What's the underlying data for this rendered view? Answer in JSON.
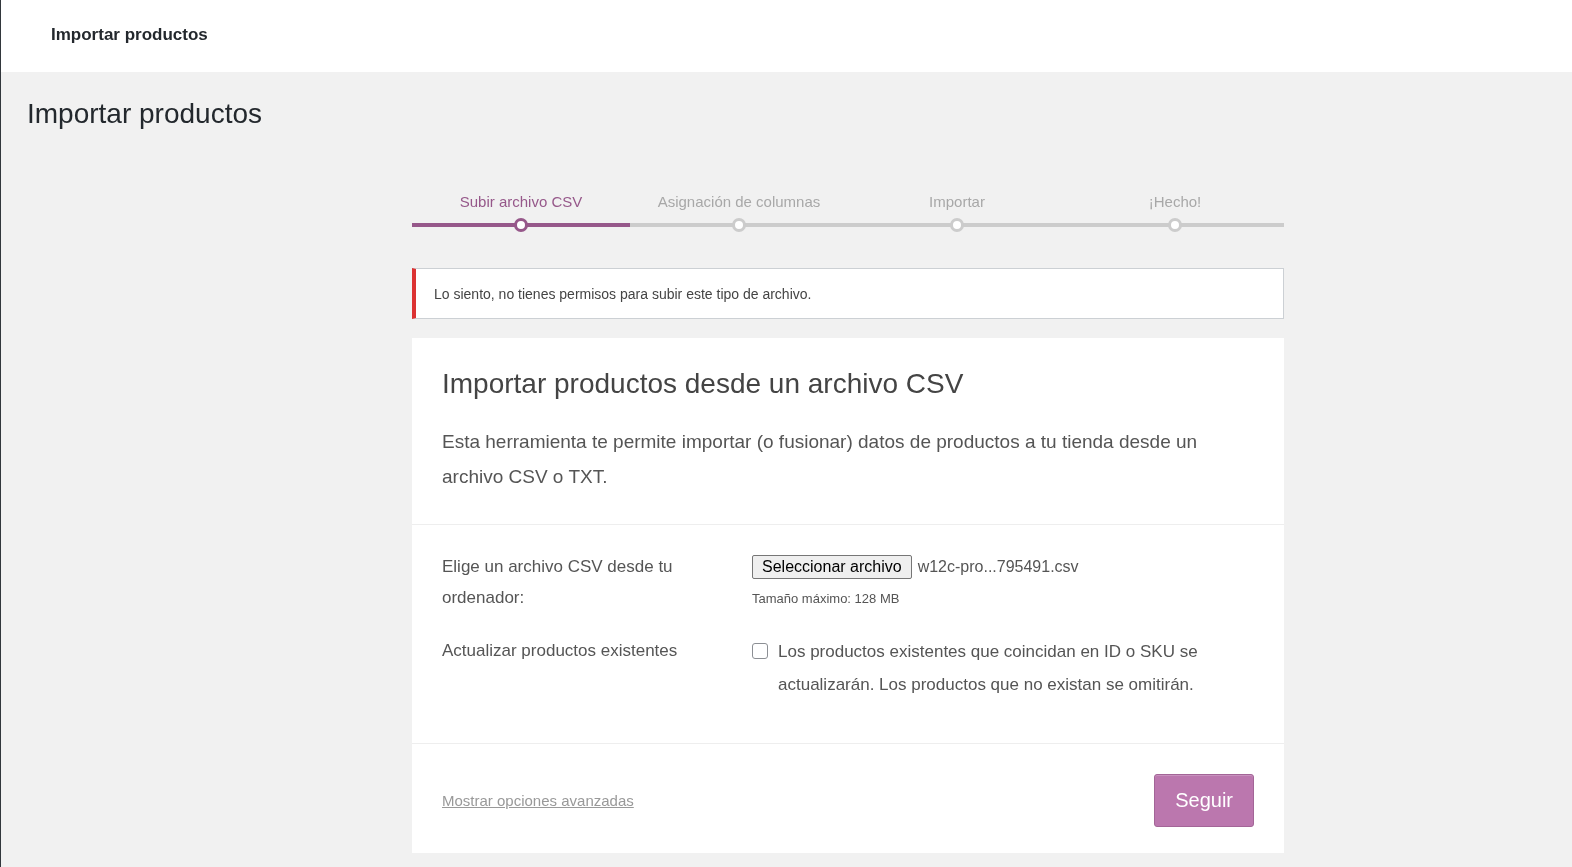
{
  "top_bar": {
    "title": "Importar productos"
  },
  "page_title": "Importar productos",
  "steps": [
    {
      "label": "Subir archivo CSV",
      "selected": true
    },
    {
      "label": "Asignación de columnas",
      "selected": false
    },
    {
      "label": "Importar",
      "selected": false
    },
    {
      "label": "¡Hecho!",
      "selected": false
    }
  ],
  "notice": {
    "kind": "error",
    "text": "Lo siento, no tienes permisos para subir este tipo de archivo."
  },
  "card": {
    "title": "Importar productos desde un archivo CSV",
    "description": "Esta herramienta te permite importar (o fusionar) datos de productos a tu tienda desde un archivo CSV o TXT.",
    "file_field": {
      "label": "Elige un archivo CSV desde tu ordenador:",
      "button": "Seleccionar archivo",
      "file_name": "w12c-pro...795491.csv",
      "hint": "Tamaño máximo: 128 MB"
    },
    "update_field": {
      "label": "Actualizar productos existentes",
      "checked": false,
      "text": "Los productos existentes que coincidan en ID o SKU se actualizarán. Los productos que no existan se omitirán."
    },
    "advanced_link": "Mostrar opciones avanzadas",
    "submit_button": "Seguir"
  }
}
